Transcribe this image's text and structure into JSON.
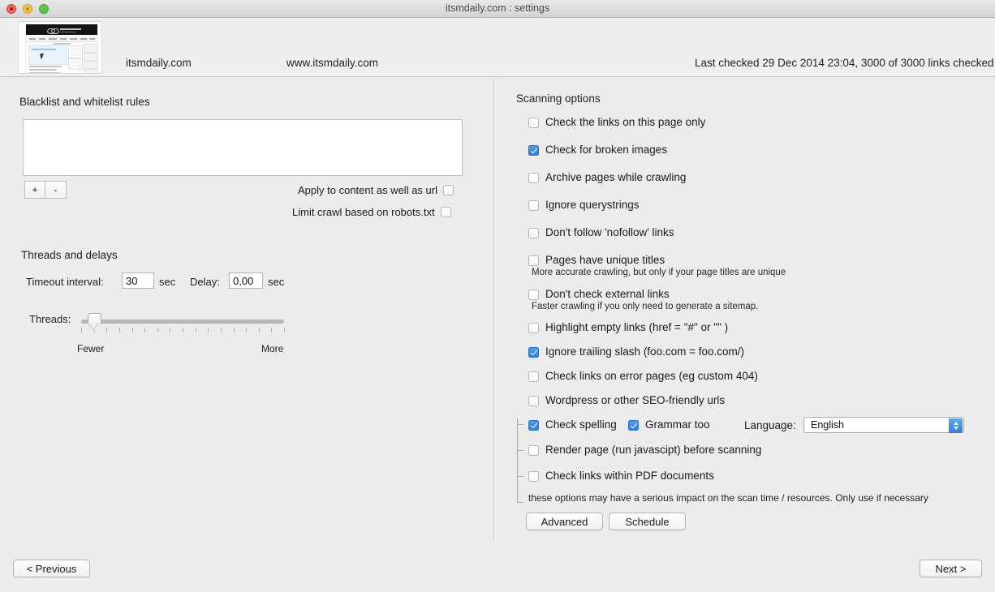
{
  "window": {
    "title": "itsmdaily.com : settings",
    "traffic_lights": [
      "close-button",
      "minimize-button",
      "zoom-button"
    ]
  },
  "header": {
    "thumbnail_alt": "site-thumbnail",
    "domain": "itsmdaily.com",
    "www": "www.itsmdaily.com",
    "status": "Last checked 29 Dec 2014 23:04, 3000 of 3000 links checked"
  },
  "left_panel": {
    "blacklist": {
      "title": "Blacklist and whitelist rules",
      "rules": [],
      "add_label": "+",
      "remove_label": "-",
      "apply_content_label": "Apply to content as well as url",
      "apply_content_checked": false,
      "robots_label": "Limit crawl based on robots.txt",
      "robots_checked": false
    },
    "threads": {
      "title": "Threads and delays",
      "timeout_label": "Timeout interval:",
      "timeout_value": "30",
      "timeout_unit": "sec",
      "delay_label": "Delay:",
      "delay_value": "0,00",
      "delay_unit": "sec",
      "threads_label": "Threads:",
      "threads_min_caption": "Fewer",
      "threads_max_caption": "More",
      "threads_position_pct": 6,
      "tick_count": 17
    }
  },
  "right_panel": {
    "title": "Scanning options",
    "options": [
      {
        "label": "Check the links on this page only",
        "checked": false,
        "note": null
      },
      {
        "label": "Check for broken images",
        "checked": true,
        "note": null
      },
      {
        "label": "Archive pages while crawling",
        "checked": false,
        "note": null
      },
      {
        "label": "Ignore querystrings",
        "checked": false,
        "note": null
      },
      {
        "label": "Don't follow 'nofollow' links",
        "checked": false,
        "note": null
      },
      {
        "label": "Pages have unique titles",
        "checked": false,
        "note": "More accurate crawling, but only if your page titles are unique"
      },
      {
        "label": "Don't check external links",
        "checked": false,
        "note": "Faster crawling if you only need to generate a sitemap."
      },
      {
        "label": "Highlight empty links (href = \"#\"  or  \"\" )",
        "checked": false,
        "note": null
      },
      {
        "label": "Ignore trailing slash (foo.com = foo.com/)",
        "checked": true,
        "note": null
      },
      {
        "label": "Check links on error pages (eg custom 404)",
        "checked": false,
        "note": null
      },
      {
        "label": "Wordpress or other SEO-friendly urls",
        "checked": false,
        "note": null
      }
    ],
    "spelling": {
      "check_spelling_label": "Check spelling",
      "check_spelling_checked": true,
      "grammar_label": "Grammar too",
      "grammar_checked": true,
      "language_label": "Language:",
      "language_value": "English"
    },
    "heavy_options": [
      {
        "label": "Render page (run javascipt) before scanning",
        "checked": false
      },
      {
        "label": "Check links within PDF documents",
        "checked": false
      }
    ],
    "impact_note": "these options may have a serious impact on the scan time / resources. Only use if necessary",
    "advanced_label": "Advanced",
    "schedule_label": "Schedule"
  },
  "footer": {
    "previous_label": "< Previous",
    "next_label": "Next >"
  },
  "colors": {
    "accent_blue": "#2f80e0",
    "window_bg": "#ececec",
    "header_bg": "#efefef"
  }
}
